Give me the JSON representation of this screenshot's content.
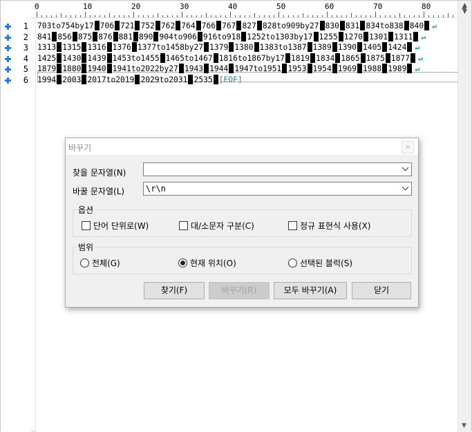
{
  "ruler": {
    "labels": [
      "0",
      "10",
      "20",
      "30",
      "40",
      "50",
      "60",
      "70",
      "80"
    ]
  },
  "lines": [
    {
      "num": "1",
      "segments": [
        "703to754by17",
        "706",
        "721",
        "752",
        "762",
        "764",
        "766",
        "767",
        "827",
        "828to909by27",
        "830",
        "831",
        "834to838",
        "840"
      ],
      "end": "↵"
    },
    {
      "num": "2",
      "segments": [
        "841",
        "856",
        "875",
        "876",
        "881",
        "890",
        "904to906",
        "916to918",
        "1252to1303by17",
        "1255",
        "1270",
        "1301",
        "1311"
      ],
      "end": "↵"
    },
    {
      "num": "3",
      "segments": [
        "1313",
        "1315",
        "1316",
        "1376",
        "1377to1458by27",
        "1379",
        "1380",
        "1383to1387",
        "1389",
        "1390",
        "1405",
        "1424"
      ],
      "end": "↵"
    },
    {
      "num": "4",
      "segments": [
        "1425",
        "1430",
        "1439",
        "1453to1455",
        "1465to1467",
        "1816to1867by17",
        "1819",
        "1834",
        "1865",
        "1875",
        "1877"
      ],
      "end": "↵"
    },
    {
      "num": "5",
      "segments": [
        "1879",
        "1880",
        "1940",
        "1941to2022by27",
        "1943",
        "1944",
        "1947to1951",
        "1953",
        "1954",
        "1969",
        "1988",
        "1989"
      ],
      "end": "↵"
    },
    {
      "num": "6",
      "segments": [
        "1994",
        "2003",
        "2017to2019",
        "2029to2031",
        "2535"
      ],
      "end": "[EOF]"
    }
  ],
  "dialog": {
    "title": "바꾸기",
    "close": "×",
    "find_label": "찾을 문자열(N)",
    "find_value": "",
    "replace_label": "바꿀 문자열(L)",
    "replace_value": "\\r\\n",
    "options_title": "옵션",
    "opt_word": "단어 단위로(W)",
    "opt_case": "대/소문자 구분(C)",
    "opt_regex": "정규 표현식 사용(X)",
    "scope_title": "범위",
    "scope_all": "전체(G)",
    "scope_current": "현재 위치(O)",
    "scope_selection": "선택된 블럭(S)",
    "scope_selected": "current",
    "btn_find": "찾기(F)",
    "btn_replace": "바꾸기(R)",
    "btn_replace_all": "모두 바꾸기(A)",
    "btn_close": "닫기"
  }
}
